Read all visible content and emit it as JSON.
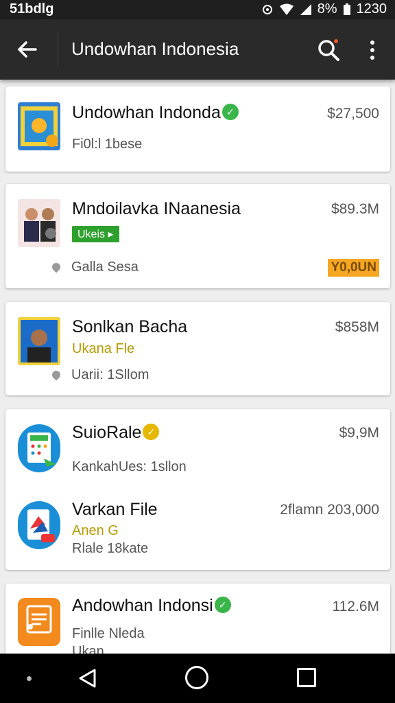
{
  "status": {
    "left_text": "51bdlg",
    "battery": "8%",
    "time": "1230"
  },
  "appbar": {
    "title": "Undowhan Indonesia"
  },
  "colors": {
    "appbar": "#2a2a2a",
    "green": "#3ab54a",
    "yellow": "#e6b800",
    "orange": "#f5a623",
    "blue": "#1a8fd8"
  },
  "listings": [
    {
      "name": "Undowhan Indonda",
      "price": "$27,500",
      "subtitle": "Fi0l:l 1bese",
      "verified_icon": "check-badge"
    },
    {
      "name": "Mndoilavka INaanesia",
      "price": "$89.3M",
      "tag": "Ukeis",
      "location": "Galla Sesa",
      "price_tag": "Y0,0UN"
    },
    {
      "name": "Sonlkan Bacha",
      "price": "$858M",
      "subtitle": "Ukana Fle",
      "location": "Uarii: 1Sllom"
    },
    {
      "name": "SuioRale",
      "price": "$9,9M",
      "subtitle": "KankahUes: 1sllon",
      "verified_icon": "gold-badge"
    },
    {
      "name": "Varkan File",
      "price": "2flamn 203,000",
      "subtitle": "Anen G",
      "subtitle2": "Rlale 18kate"
    },
    {
      "name": "Andowhan Indonsi",
      "price": "112.6M",
      "subtitle": "Finlle Nleda",
      "subtitle2": "Ukan..."
    }
  ],
  "nav": {
    "icons": [
      "back-icon",
      "home-icon",
      "recents-icon"
    ]
  }
}
